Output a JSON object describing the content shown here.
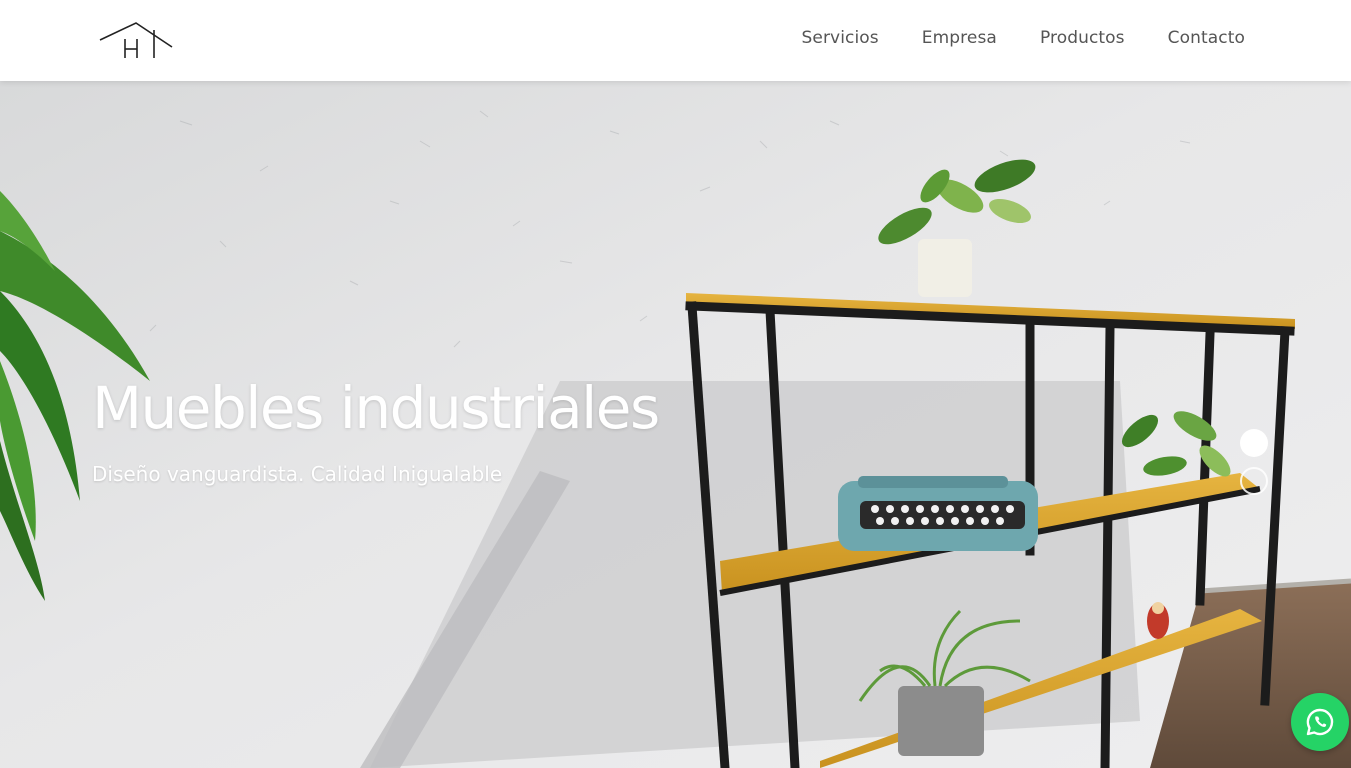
{
  "header": {
    "nav": [
      {
        "label": "Servicios"
      },
      {
        "label": "Empresa"
      },
      {
        "label": "Productos"
      },
      {
        "label": "Contacto"
      }
    ]
  },
  "hero": {
    "title": "Muebles industriales",
    "subtitle": "Diseño vanguardista. Calidad Inigualable",
    "slides": {
      "total": 2,
      "active": 1
    }
  },
  "logo": {
    "icon": "house-h-logo"
  },
  "floating": {
    "icon": "whatsapp-icon",
    "color": "#25d366"
  },
  "colors": {
    "nav_text": "#555555",
    "hero_text": "#ffffff",
    "wood": "#d9a531",
    "metal": "#1c1c1c"
  }
}
